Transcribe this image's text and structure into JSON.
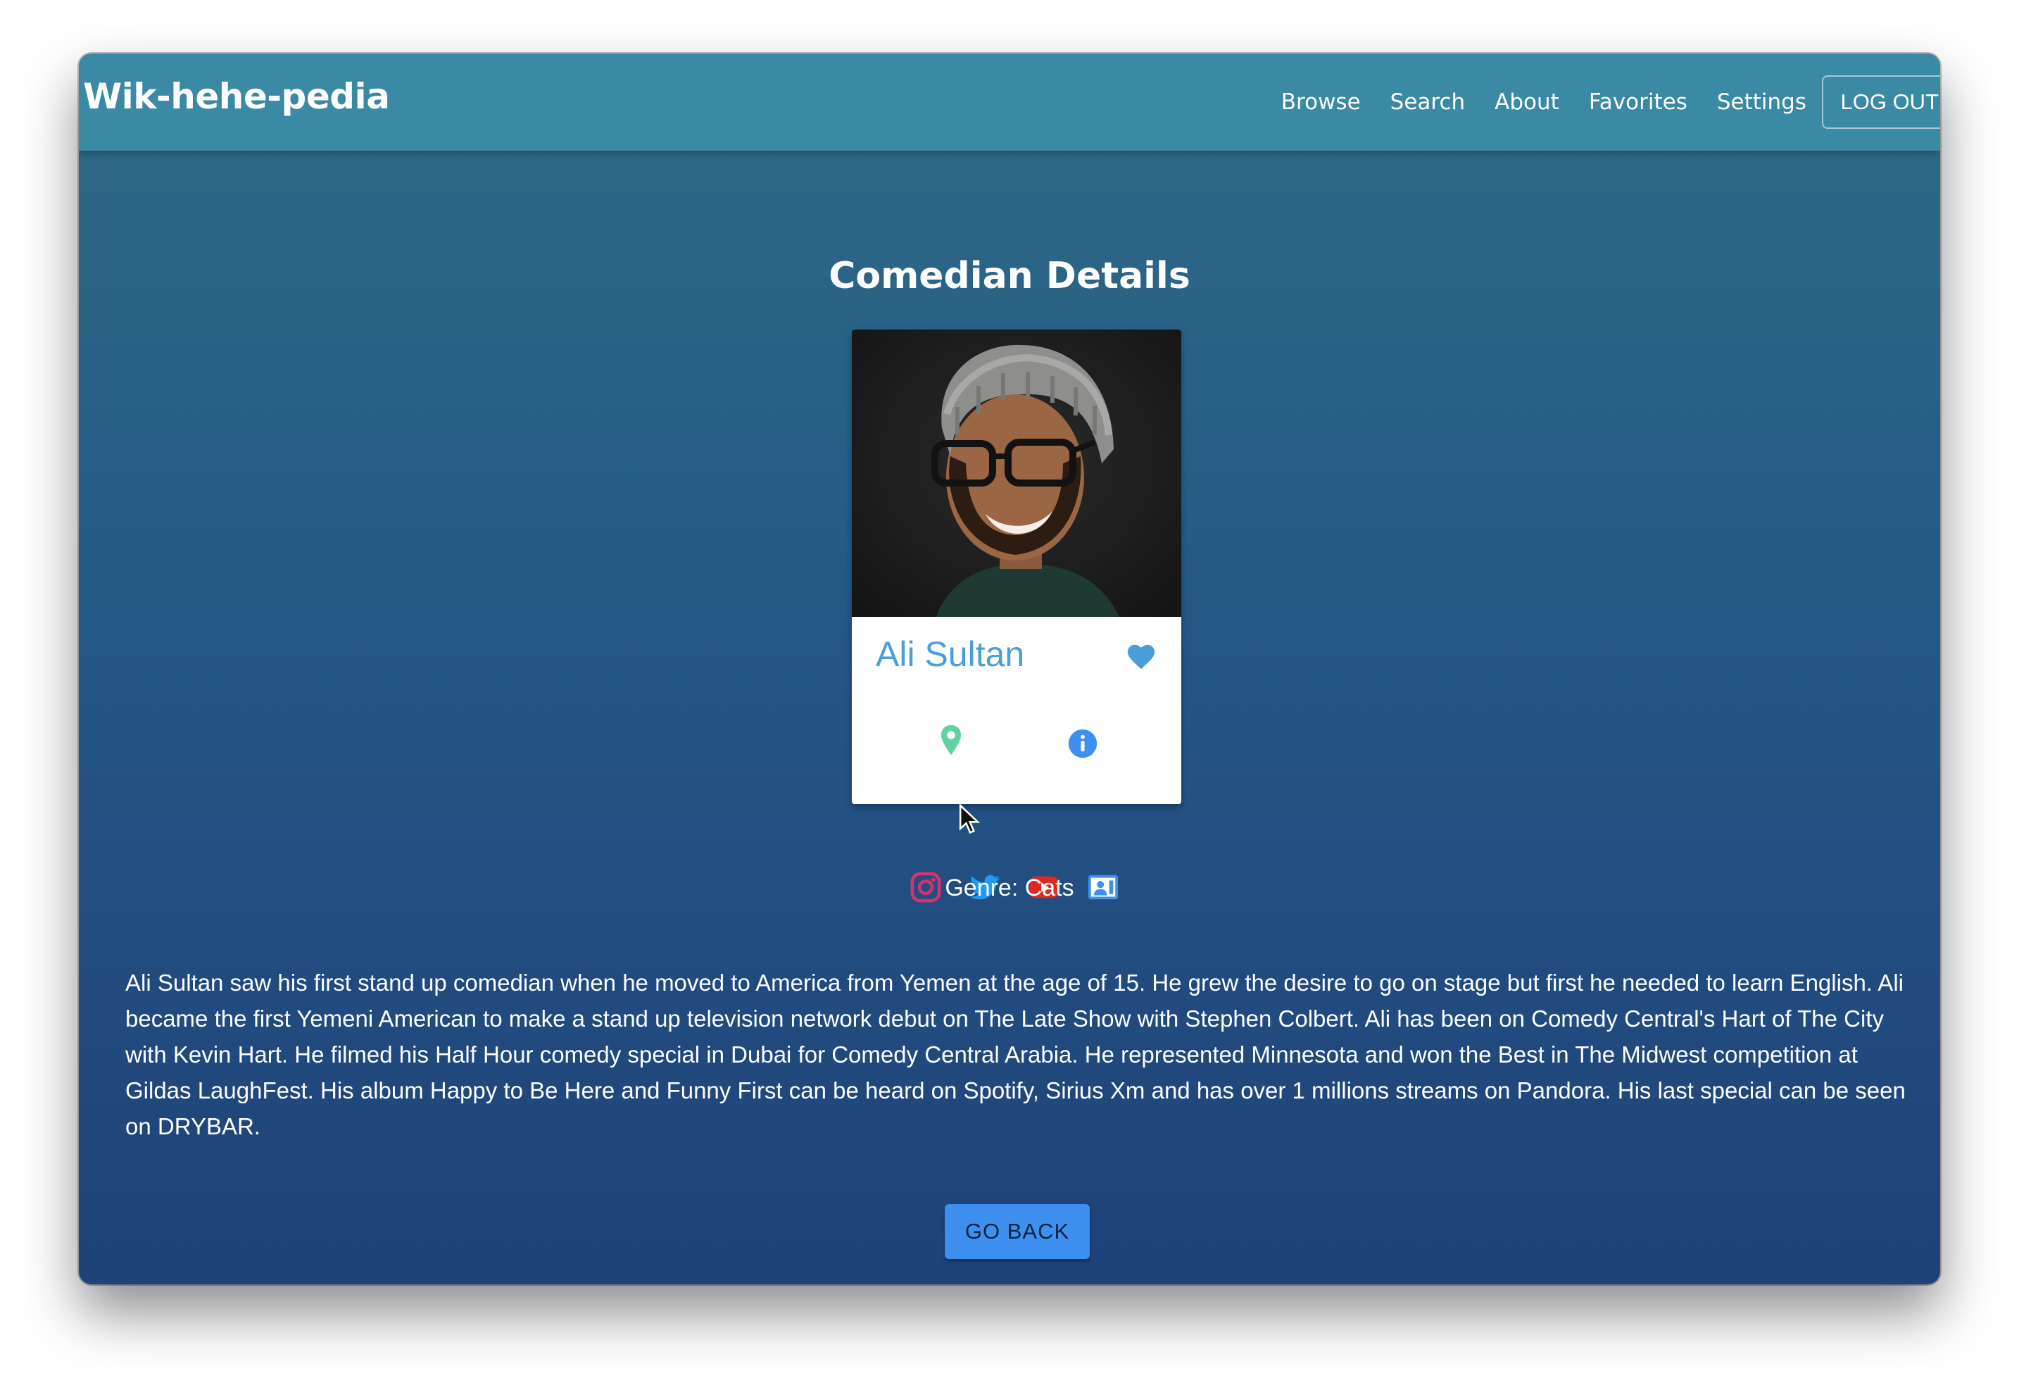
{
  "app": {
    "brand": "Wik-hehe-pedia"
  },
  "nav": {
    "links": [
      "Browse",
      "Search",
      "About",
      "Favorites",
      "Settings"
    ],
    "logout_label": "LOG OUT"
  },
  "page": {
    "title": "Comedian Details"
  },
  "comedian": {
    "name": "Ali Sultan",
    "favorited": true,
    "genre_text": "Genre: Cats",
    "bio": "Ali Sultan saw his first stand up comedian when he moved to America from Yemen at the age of 15. He grew the desire to go on stage but first he needed to learn English. Ali became the first Yemeni American to make a stand up television network debut on The Late Show with Stephen Colbert. Ali has been on Comedy Central's Hart of The City with Kevin Hart. He filmed his Half Hour comedy special in Dubai for Comedy Central Arabia. He represented Minnesota and won the Best in The Midwest competition at Gildas LaughFest. His album Happy to Be Here and Funny First can be heard on Spotify, Sirius Xm and has over 1 millions streams on Pandora. His last special can be seen on DRYBAR."
  },
  "card_icons": {
    "favorite": "heart-icon",
    "location": "location-pin-icon",
    "info": "info-icon"
  },
  "socials": [
    {
      "icon": "instagram-icon",
      "color": "#d6336c"
    },
    {
      "icon": "twitter-icon",
      "color": "#1d9bf0"
    },
    {
      "icon": "youtube-icon",
      "color": "#e0281e"
    },
    {
      "icon": "contact-card-icon",
      "color": "#3d8ff0"
    }
  ],
  "actions": {
    "go_back_label": "GO BACK"
  },
  "colors": {
    "navbar": "#3a8aa6",
    "accent": "#4a9fd8",
    "button": "#3d8ff0",
    "location": "#5fd4a0"
  }
}
